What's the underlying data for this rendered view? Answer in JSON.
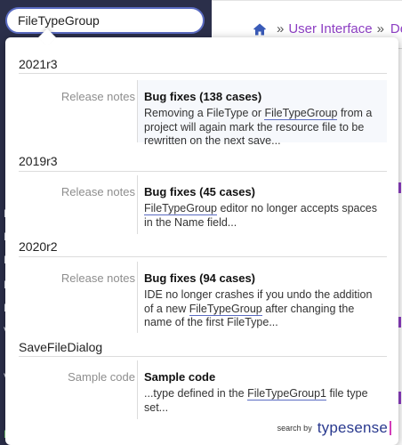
{
  "search": {
    "value": "FileTypeGroup"
  },
  "breadcrumb": {
    "home_icon": "home-icon",
    "separator": "»",
    "item_1": "User Interface",
    "item_2": "De"
  },
  "sidebar": {
    "letters": [
      "L",
      "N",
      "N",
      "N",
      "N",
      "V",
      "V",
      "E"
    ]
  },
  "results": {
    "groups": [
      {
        "title": "2021r3",
        "type": "Release notes",
        "heading": "Bug fixes (138 cases)",
        "snippet_before": "Removing a FileType or ",
        "snippet_highlight": "FileTypeGroup",
        "snippet_after": " from a project will again mark the resource file to be rewritten on the next save..."
      },
      {
        "title": "2019r3",
        "type": "Release notes",
        "heading": "Bug fixes (45 cases)",
        "snippet_before": "",
        "snippet_highlight": "FileTypeGroup",
        "snippet_after": " editor no longer accepts spaces in the Name field..."
      },
      {
        "title": "2020r2",
        "type": "Release notes",
        "heading": "Bug fixes (94 cases)",
        "snippet_before": "IDE no longer crashes if you undo the addition of a new ",
        "snippet_highlight": "FileTypeGroup",
        "snippet_after": " after changing the name of the first FileType..."
      },
      {
        "title": "SaveFileDialog",
        "type": "Sample code",
        "heading": "Sample code",
        "snippet_before": "...type defined in the ",
        "snippet_highlight": "FileTypeGroup1",
        "snippet_after": " file type set..."
      }
    ]
  },
  "footer": {
    "search_by": "search by",
    "brand": "typesense"
  },
  "colors": {
    "sidebar_bg": "#2b2f4a",
    "accent_purple": "#8d3ec3",
    "search_border": "#5b6cc3",
    "brand_blue": "#2a3a8f"
  }
}
